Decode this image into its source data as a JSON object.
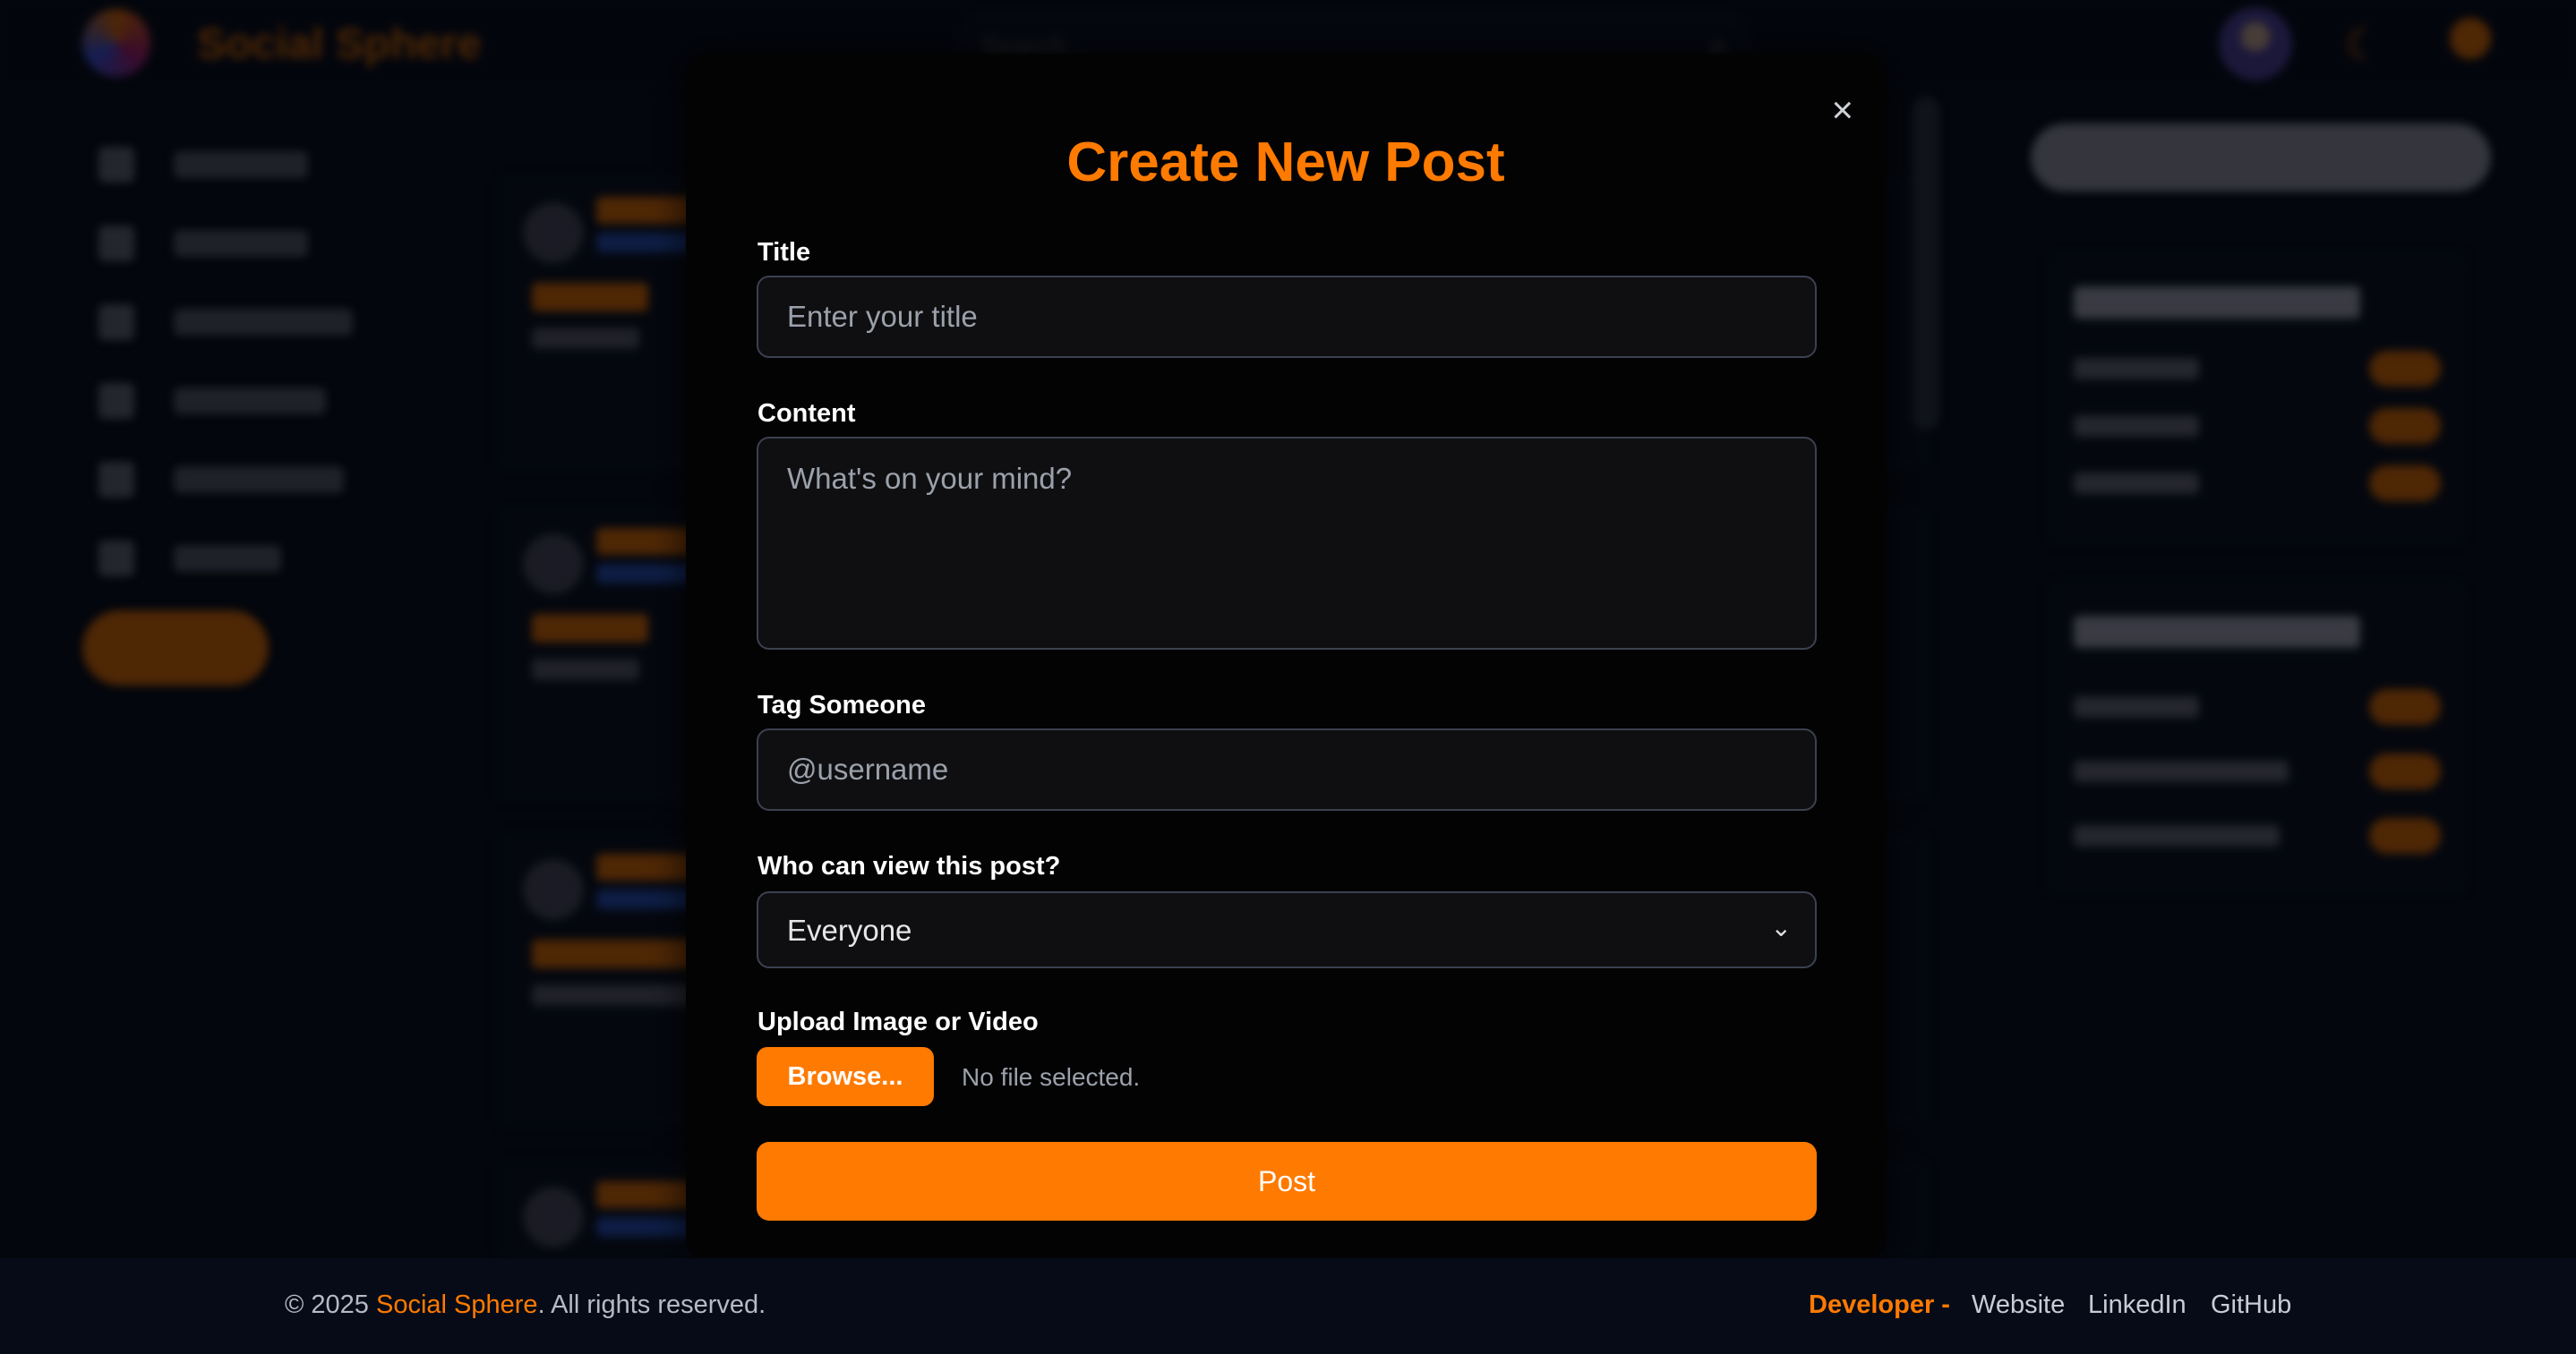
{
  "app": {
    "brand": "Social Sphere",
    "search_placeholder": "Search..."
  },
  "modal": {
    "title": "Create New Post",
    "close_symbol": "×",
    "title_field": {
      "label": "Title",
      "placeholder": "Enter your title",
      "value": ""
    },
    "content_field": {
      "label": "Content",
      "placeholder": "What's on your mind?",
      "value": ""
    },
    "tag_field": {
      "label": "Tag Someone",
      "placeholder": "@username",
      "value": ""
    },
    "visibility": {
      "label": "Who can view this post?",
      "selected": "Everyone"
    },
    "upload": {
      "label": "Upload Image or Video",
      "button": "Browse...",
      "status": "No file selected."
    },
    "submit_label": "Post"
  },
  "footer": {
    "copyright_prefix": "© 2025 ",
    "brand": "Social Sphere",
    "copyright_suffix": ". All rights reserved.",
    "developer_label": "Developer -",
    "links": [
      "Website",
      "LinkedIn",
      "GitHub"
    ]
  },
  "colors": {
    "accent": "#ff7a00",
    "background": "#060b17",
    "modal_background": "#030303"
  },
  "icons": [
    "close-icon",
    "chevron-down-icon",
    "search-icon",
    "moon-icon",
    "sun-icon"
  ]
}
